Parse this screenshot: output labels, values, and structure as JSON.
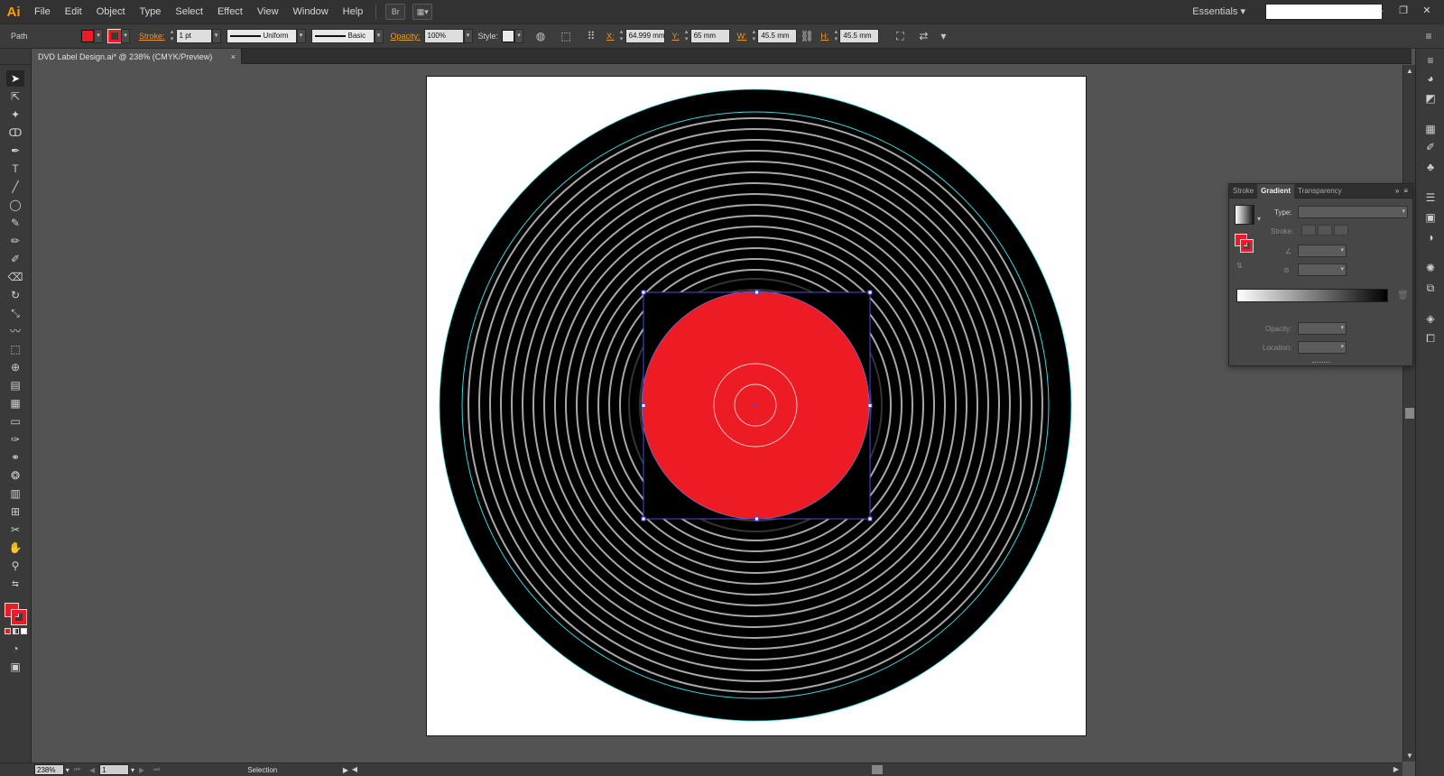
{
  "menubar": {
    "app_logo": "Ai",
    "items": [
      "File",
      "Edit",
      "Object",
      "Type",
      "Select",
      "Effect",
      "View",
      "Window",
      "Help"
    ],
    "bridge_label": "Br",
    "workspace": "Essentials",
    "window_controls": [
      "–",
      "❐",
      "✕"
    ]
  },
  "controlbar": {
    "selection_type": "Path",
    "fill_color": "#ed1c24",
    "stroke_label": "Stroke:",
    "stroke_weight": "1 pt",
    "variable_width": "Uniform",
    "brush": "Basic",
    "opacity_label": "Opacity:",
    "opacity": "100%",
    "style_label": "Style:",
    "x_label": "X:",
    "x_value": "64.999 mm",
    "y_label": "Y:",
    "y_value": "65 mm",
    "w_label": "W:",
    "w_value": "45.5 mm",
    "h_label": "H:",
    "h_value": "45.5 mm"
  },
  "document": {
    "tab_title": "DVD Label Design.ai* @ 238% (CMYK/Preview)",
    "close": "×"
  },
  "artwork": {
    "disc_color": "#000000",
    "groove_color": "#a8a8a8",
    "guide_color": "#3ad6e0",
    "label_color": "#ed1c24",
    "selection_color": "#4b4bdc"
  },
  "statusbar": {
    "zoom": "238%",
    "page": "1",
    "status_text": "Selection"
  },
  "gradient_panel": {
    "tabs": [
      "Stroke",
      "Gradient",
      "Transparency"
    ],
    "active_tab": "Gradient",
    "type_label": "Type:",
    "stroke_label": "Stroke:",
    "opacity_label": "Opacity:",
    "location_label": "Location:",
    "collapse": "»"
  }
}
